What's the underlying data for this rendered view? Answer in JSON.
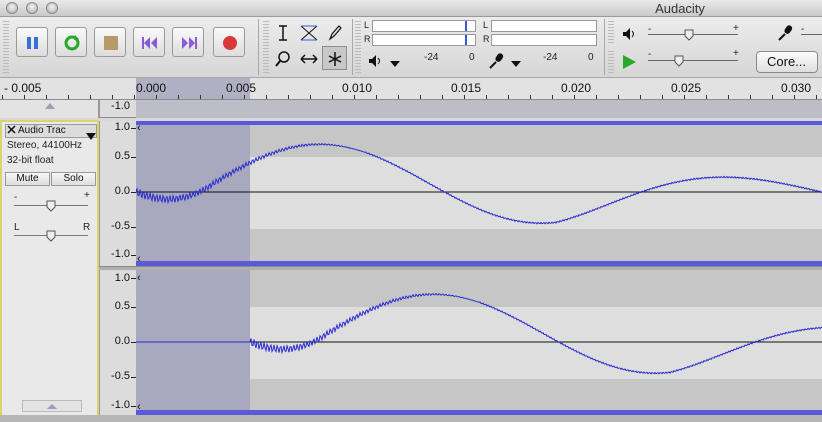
{
  "app": {
    "title": "Audacity"
  },
  "transport": {
    "pause": "pause-icon",
    "play": "play-icon",
    "stop": "stop-icon",
    "skip_start": "skip-to-start-icon",
    "skip_end": "skip-to-end-icon",
    "record": "record-icon"
  },
  "meters": {
    "output_L": "L",
    "output_R": "R",
    "input_L": "L",
    "input_R": "R",
    "output_ticks": [
      "-24",
      "0"
    ],
    "input_ticks": [
      "-24",
      "0"
    ]
  },
  "mixer": {
    "minus": "-",
    "plus": "+"
  },
  "device": {
    "host_label": "Core..."
  },
  "ruler": {
    "ticks": [
      "- 0.005",
      "0.000",
      "0.005",
      "0.010",
      "0.015",
      "0.020",
      "0.025",
      "0.030"
    ]
  },
  "track": {
    "name": "Audio Trac",
    "format_rate": "Stereo, 44100Hz",
    "bit_depth": "32-bit float",
    "mute_label": "Mute",
    "solo_label": "Solo",
    "gain_minus": "-",
    "gain_plus": "+",
    "pan_left": "L",
    "pan_right": "R"
  },
  "vscale": {
    "top_labels": [
      "1.0",
      "0.5",
      "0.0",
      "-0.5",
      "-1.0"
    ],
    "bottom_labels": [
      "1.0",
      "0.5",
      "0.0",
      "-0.5",
      "-1.0"
    ],
    "prev_track_label": "-1.0"
  },
  "colors": {
    "waveform": "#2a2ad0",
    "selection": "#a8a8be",
    "track_bg": "#c8c8c8",
    "focus_border": "#d9d470"
  }
}
